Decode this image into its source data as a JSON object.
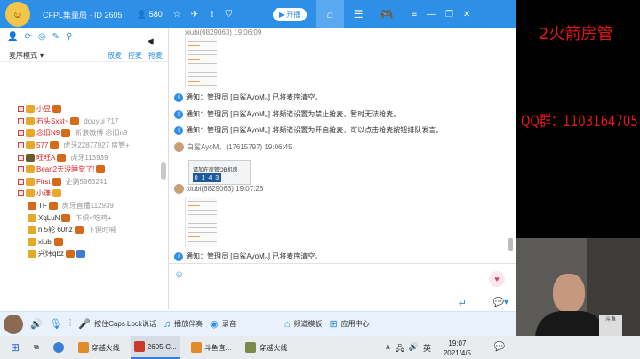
{
  "app": {
    "title": "CFPL集量局 · ID 2605",
    "viewer_count": "580",
    "open_button": "开播"
  },
  "left": {
    "mode": "麦序模式",
    "links": [
      "放麦",
      "控麦",
      "抢麦"
    ]
  },
  "members": [
    {
      "name": "小昱",
      "note": "",
      "red": true
    },
    {
      "name": "石头Sxst~",
      "note": "douyui 717",
      "red": true
    },
    {
      "name": "念旧N9",
      "note": "新浪微博 念旧n9",
      "red": true
    },
    {
      "name": "577",
      "note": "虎牙22877927 房管+",
      "red": true
    },
    {
      "name": "旺旺A",
      "note": "虎牙113939",
      "red": true
    },
    {
      "name": "Bean2天没睡觉了!",
      "note": "",
      "red": true
    },
    {
      "name": "First",
      "note": "企鹅5963241",
      "red": true
    },
    {
      "name": "小谦",
      "note": "",
      "red": true
    },
    {
      "name": "TF",
      "note": "虎牙直播112939",
      "red": false
    },
    {
      "name": "XqLuN",
      "note": "下俱<吃鸡+",
      "red": false
    },
    {
      "name": "n  5轮 60hz",
      "note": "下俱时喊",
      "red": false
    },
    {
      "name": "xiubi",
      "note": "",
      "red": false
    },
    {
      "name": "兴炜qbz",
      "note": "",
      "red": false
    }
  ],
  "chat": {
    "top_line": "xiubi(6829063) 19:06:09",
    "notices": [
      "通知：管理员 [白鲨AyoM。] 已将麦序清空。",
      "通知：管理员 [白鲨AyoM。] 将频道设置为禁止抢麦，暂时无法抢麦。",
      "通知：管理员 [白鲨AyoM。] 将频道设置为开启抢麦，可以点击抢麦按钮排队发言。"
    ],
    "msg1_user": "白鲨AyoM。(17615797) 19:06:45",
    "img_text_top": "请加在房管OB机房",
    "img_code": "0 1 4 3",
    "msg2_user": "xiubi(6829063) 19:07:26",
    "last_notice": "通知：管理员 [白鲨AyoM。] 已将麦序清空。"
  },
  "bottom_bar": {
    "caps": "按住Caps Lock说话",
    "accompany": "播放伴奏",
    "record": "录音",
    "template": "频道模板",
    "user_center": "应用中心"
  },
  "overlay": {
    "line1": "2火箭房管",
    "line2": "QQ群：1103164705"
  },
  "taskbar": {
    "items": [
      "穿越火线",
      "2605-C...",
      "斗鱼直...",
      "穿越火线"
    ],
    "time": "19:07",
    "date": "2021/4/5",
    "ime": "英"
  },
  "webcam": {
    "cup_text": "斗鱼"
  }
}
